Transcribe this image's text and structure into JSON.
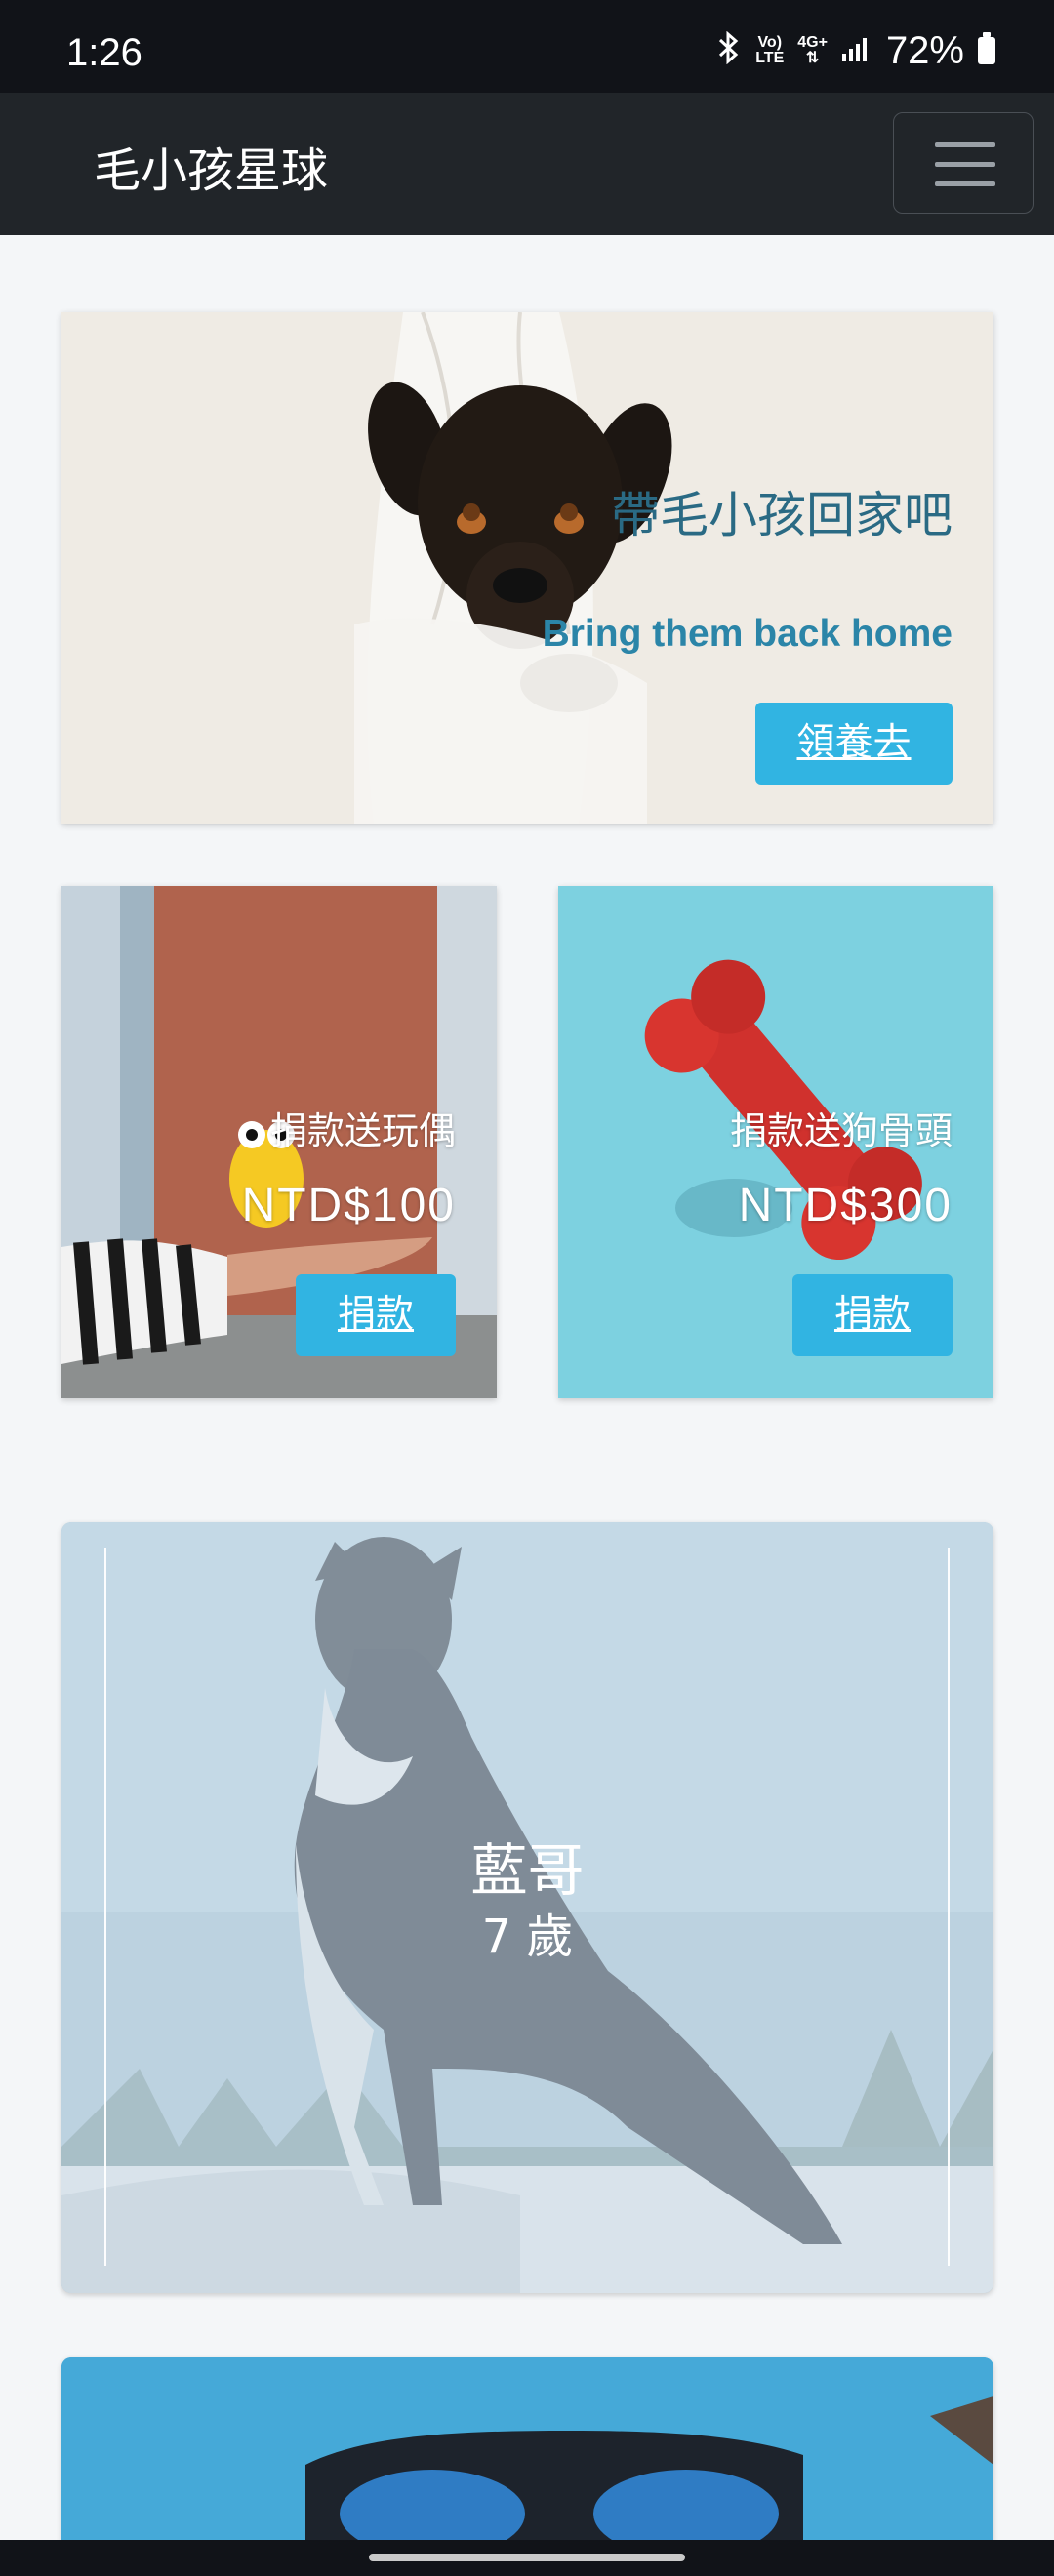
{
  "status_bar": {
    "time": "1:26",
    "battery_percent": "72%",
    "network_label_top": "Vo)",
    "network_label_bottom": "LTE",
    "network_type": "4G+",
    "icons": [
      "bluetooth-icon",
      "volte-icon",
      "4g-icon",
      "signal-icon",
      "battery-icon"
    ]
  },
  "navbar": {
    "brand": "毛小孩星球",
    "menu_icon": "hamburger-icon"
  },
  "hero": {
    "title": "帶毛小孩回家吧",
    "subtitle": "Bring them back home",
    "button_label": "領養去"
  },
  "donations": [
    {
      "title": "捐款送玩偶",
      "price": "NTD$100",
      "button_label": "捐款"
    },
    {
      "title": "捐款送狗骨頭",
      "price": "NTD$300",
      "button_label": "捐款"
    }
  ],
  "pet_card": {
    "name": "藍哥",
    "age": "7 歲"
  },
  "colors": {
    "navbar_bg": "#212529",
    "button_bg": "#31b4e2",
    "hero_title": "#2a6a84",
    "hero_subtitle": "#2b85a8",
    "page_bg": "#f4f6f8"
  }
}
